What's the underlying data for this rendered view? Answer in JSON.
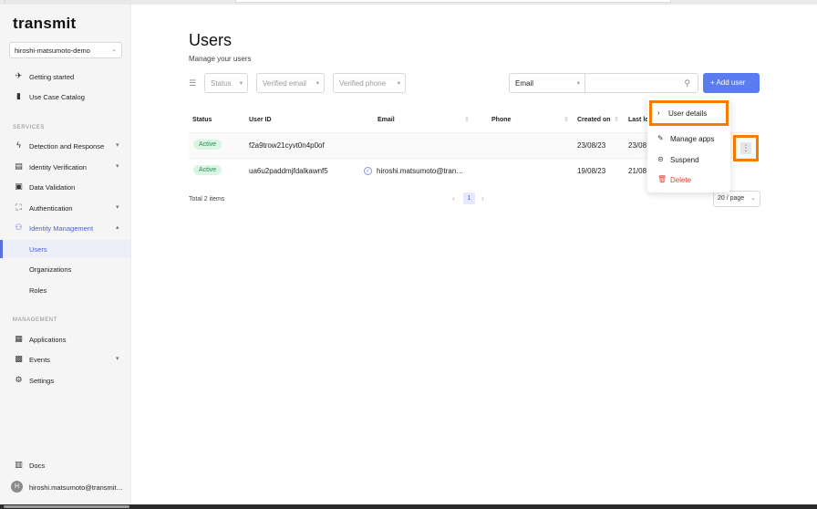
{
  "app": {
    "logo_text": "transmit",
    "tenant": "hiroshi-matsumoto-demo"
  },
  "sidebar": {
    "top_items": [
      {
        "label": "Getting started",
        "icon": "rocket-icon"
      },
      {
        "label": "Use Case Catalog",
        "icon": "book-icon"
      }
    ],
    "services_title": "SERVICES",
    "services": [
      {
        "label": "Detection and Response",
        "icon": "bolt-icon",
        "has_caret": true
      },
      {
        "label": "Identity Verification",
        "icon": "id-card-icon",
        "has_caret": true
      },
      {
        "label": "Data Validation",
        "icon": "data-icon",
        "has_caret": false
      },
      {
        "label": "Authentication",
        "icon": "scan-icon",
        "has_caret": true
      },
      {
        "label": "Identity Management",
        "icon": "people-icon",
        "has_caret": true
      },
      {
        "label": "Users",
        "icon": "",
        "has_caret": false
      },
      {
        "label": "Organizations",
        "icon": "",
        "has_caret": false
      },
      {
        "label": "Roles",
        "icon": "",
        "has_caret": false
      }
    ],
    "management_title": "MANAGEMENT",
    "management": [
      {
        "label": "Applications",
        "icon": "apps-icon",
        "has_caret": false
      },
      {
        "label": "Events",
        "icon": "calendar-icon",
        "has_caret": true
      },
      {
        "label": "Settings",
        "icon": "settings-icon",
        "has_caret": false
      }
    ],
    "docs_label": "Docs",
    "user_initial": "H",
    "user_email": "hiroshi.matsumoto@transmit…"
  },
  "page": {
    "title": "Users",
    "subtitle": "Manage your users"
  },
  "filters": {
    "status": "Status",
    "verified_email": "Verified email",
    "verified_phone": "Verified phone",
    "search_field": "Email",
    "search_value": "",
    "add_user": "+ Add user"
  },
  "table": {
    "headers": {
      "status": "Status",
      "user_id": "User ID",
      "email": "Email",
      "phone": "Phone",
      "created_on": "Created on",
      "last_login": "Last lo"
    },
    "rows": [
      {
        "status": "Active",
        "user_id": "f2a9trow21cyvt0n4p0of",
        "email": "",
        "phone": "",
        "created_on": "23/08/23",
        "last_login": "23/08"
      },
      {
        "status": "Active",
        "user_id": "ua6u2paddmjfdalkawnf5",
        "email": "hiroshi.matsumoto@tran…",
        "phone": "",
        "created_on": "19/08/23",
        "last_login": "21/08"
      }
    ]
  },
  "pagination": {
    "total": "Total 2 items",
    "current_page": "1",
    "per_page": "20 / page"
  },
  "context_menu": {
    "items": [
      {
        "label": "User details",
        "icon": "chevron-right-icon"
      },
      {
        "label": "Manage apps",
        "icon": "pencil-icon"
      },
      {
        "label": "Suspend",
        "icon": "suspend-icon"
      },
      {
        "label": "Delete",
        "icon": "trash-icon"
      }
    ]
  },
  "colors": {
    "accent": "#5b7cf0",
    "highlight": "#f57c00",
    "active_badge_bg": "#d9f5e4",
    "delete_red": "#e0403a"
  }
}
